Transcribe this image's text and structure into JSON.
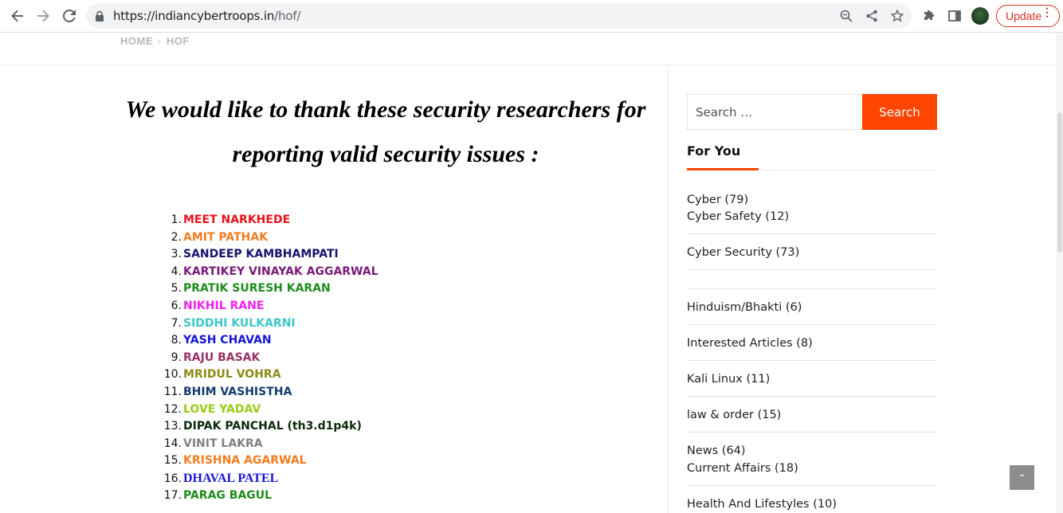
{
  "browser": {
    "url_host": "https://indiancybertroops.in",
    "url_path": "/hof/",
    "update_label": "Update",
    "update_dots": "⋮",
    "icons": [
      "back-icon",
      "forward-icon",
      "reload-icon",
      "lock-icon",
      "zoom-icon",
      "share-icon",
      "star-icon",
      "extensions-icon",
      "side-panel-icon",
      "avatar"
    ]
  },
  "breadcrumb": {
    "home": "HOME",
    "separator": "›",
    "current": "HOF"
  },
  "main": {
    "heading_line1": "We would like to thank these security researchers for",
    "heading_line2": "reporting valid security issues :",
    "researchers": [
      {
        "num": "1.",
        "name": "MEET NARKHEDE",
        "color": "#e8141a"
      },
      {
        "num": "2.",
        "name": "AMIT PATHAK",
        "color": "#f57c1f"
      },
      {
        "num": "3.",
        "name": "SANDEEP KAMBHAMPATI",
        "color": "#14146e"
      },
      {
        "num": "4.",
        "name": "KARTIKEY VINAYAK AGGARWAL",
        "color": "#7a1a7a"
      },
      {
        "num": "5.",
        "name": "PRATIK SURESH KARAN",
        "color": "#1e8c1e"
      },
      {
        "num": "6.",
        "name": "NIKHIL RANE",
        "color": "#ee22ee"
      },
      {
        "num": "7.",
        "name": "SIDDHI KULKARNI",
        "color": "#3cc8c8"
      },
      {
        "num": "8.",
        "name": "YASH CHAVAN",
        "color": "#1414dc"
      },
      {
        "num": "9.",
        "name": "RAJU BASAK",
        "color": "#993366"
      },
      {
        "num": "10.",
        "name": "MRIDUL VOHRA",
        "color": "#8c8c14"
      },
      {
        "num": "11.",
        "name": "BHIM VASHISTHA",
        "color": "#143c6e"
      },
      {
        "num": "12.",
        "name": "LOVE YADAV",
        "color": "#9acd14"
      },
      {
        "num": "13.",
        "name": "DIPAK PANCHAL (th3.d1p4k)",
        "color": "#0a2a0a"
      },
      {
        "num": "14.",
        "name": "VINIT LAKRA",
        "color": "#808080"
      },
      {
        "num": "15.",
        "name": "KRISHNA AGARWAL",
        "color": "#f57c1f"
      },
      {
        "num": "16.",
        "name": "DHAVAL PATEL",
        "color": "#1414dc"
      },
      {
        "num": "17.",
        "name": "PARAG BAGUL",
        "color": "#1e8c1e"
      }
    ]
  },
  "sidebar": {
    "search_placeholder": "Search …",
    "search_button": "Search",
    "for_you": "For You",
    "accent_color": "#ff4500",
    "categories": [
      "Cyber (79)",
      "Cyber Safety (12)",
      "Cyber Security (73)",
      "Hinduism/Bhakti (6)",
      "Interested Articles (8)",
      "Kali Linux (11)",
      "law & order (15)",
      "News (64)",
      "Current Affairs (18)",
      "Health And Lifestyles (10)"
    ]
  },
  "back_to_top": "⌃"
}
